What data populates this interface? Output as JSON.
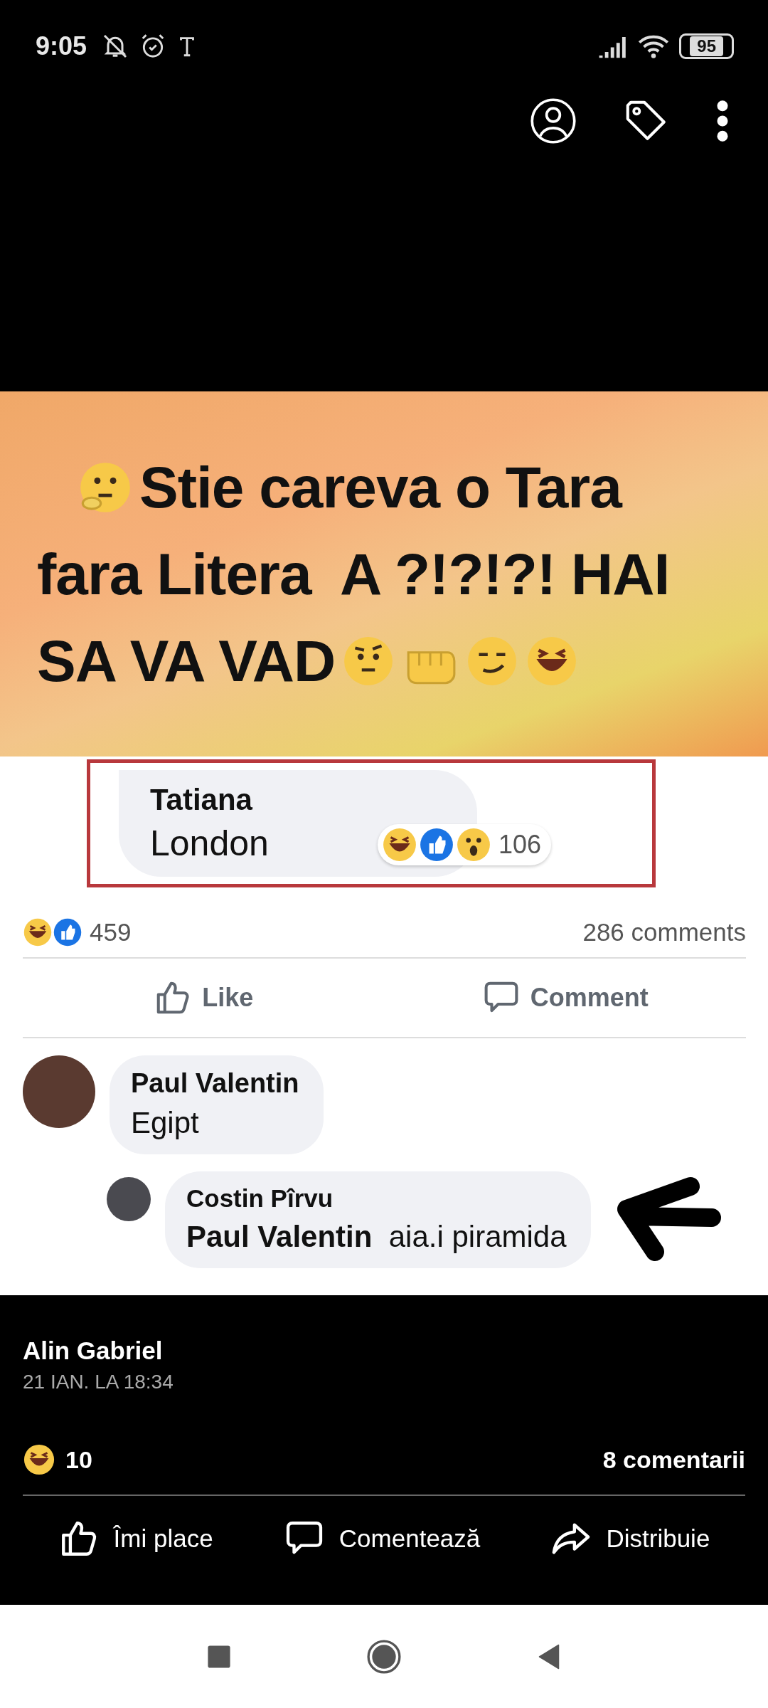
{
  "status_bar": {
    "time": "9:05",
    "battery": "95"
  },
  "photo": {
    "banner_lines": [
      "Stie careva o Tara",
      "fara Litera  A ?!?!?! HAI",
      "SA VA VAD"
    ],
    "quoted_comment": {
      "author": "Tatiana",
      "text": "London",
      "reaction_count": "106"
    },
    "reaction_count": "459",
    "comments_count": "286 comments",
    "actions": [
      {
        "kind": "like",
        "label": "Like"
      },
      {
        "kind": "comment",
        "label": "Comment"
      }
    ],
    "comments": [
      {
        "author": "Paul Valentin",
        "text": "Egipt",
        "replies": [
          {
            "author": "Costin Pîrvu",
            "mention": "Paul Valentin",
            "text": "aia.i piramida"
          }
        ]
      }
    ]
  },
  "post": {
    "author": "Alin Gabriel",
    "timestamp": "21 IAN. LA 18:34",
    "reaction_count": "10",
    "comments_count": "8 comentarii",
    "actions": [
      {
        "kind": "like",
        "label": "Îmi place"
      },
      {
        "kind": "comment",
        "label": "Comentează"
      },
      {
        "kind": "share",
        "label": "Distribuie"
      }
    ]
  }
}
